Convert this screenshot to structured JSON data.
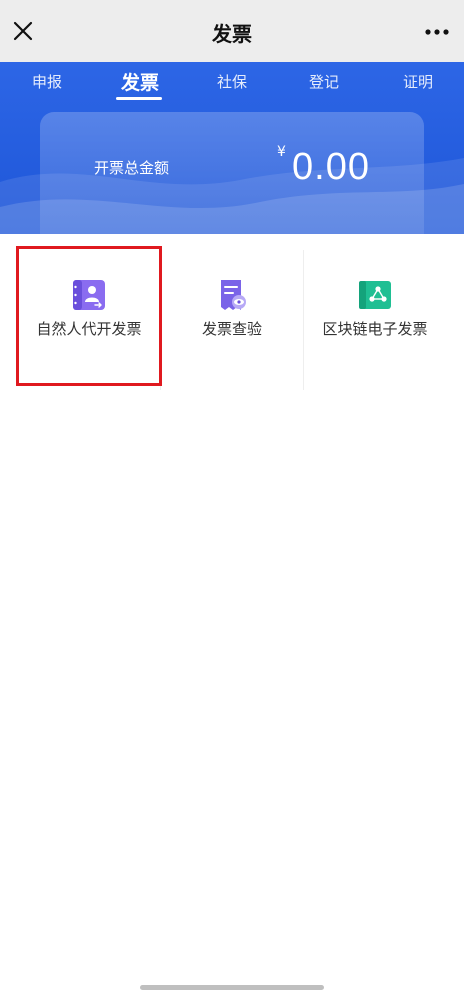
{
  "navbar": {
    "title": "发票",
    "close_icon": "close-icon",
    "more_icon": "more-dots-icon"
  },
  "tabs": [
    {
      "label": "申报",
      "active": false
    },
    {
      "label": "发票",
      "active": true
    },
    {
      "label": "社保",
      "active": false
    },
    {
      "label": "登记",
      "active": false
    },
    {
      "label": "证明",
      "active": false
    }
  ],
  "summary": {
    "label": "开票总金额",
    "currency": "¥",
    "amount": "0.00"
  },
  "services": [
    {
      "label": "自然人代开发票",
      "icon": "natural-person-invoice-icon",
      "color": "#7b5ce6",
      "highlighted": true
    },
    {
      "label": "发票查验",
      "icon": "invoice-verify-icon",
      "color": "#6f5de3"
    },
    {
      "label": "区块链电子发票",
      "icon": "blockchain-invoice-icon",
      "color": "#19b88f"
    }
  ],
  "colors": {
    "header_blue": "#2d66e6",
    "highlight_red": "#e0191f",
    "navbar_bg": "#ededed"
  }
}
